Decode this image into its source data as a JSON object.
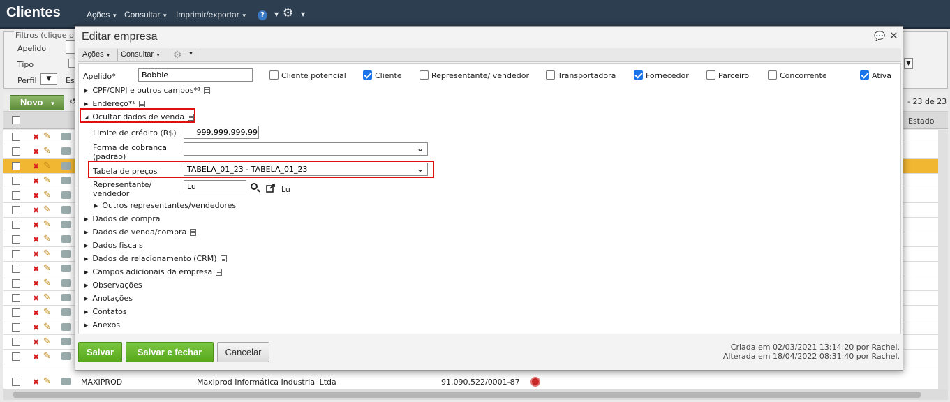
{
  "app": {
    "title": "Clientes",
    "menus": [
      {
        "label": "Ações"
      },
      {
        "label": "Consultar"
      },
      {
        "label": "Imprimir/exportar"
      }
    ],
    "help_label": "?"
  },
  "filters": {
    "legend": "Filtros (clique p",
    "apelido_label": "Apelido",
    "tipo_label": "Tipo",
    "perfil_label": "Perfil",
    "es_label": "Es"
  },
  "grid": {
    "new_label": "Novo",
    "pager": "23 de 23",
    "estado_header": "Estado",
    "last_row": {
      "apelido": "MAXIPROD",
      "nome": "Maxiprod Informática Industrial Ltda",
      "cnpj": "91.090.522/0001-87"
    }
  },
  "dialog": {
    "title": "Editar empresa",
    "toolbar": {
      "acoes": "Ações",
      "consultar": "Consultar"
    },
    "apelido_label": "Apelido*",
    "apelido_value": "Bobbie",
    "checkboxes": [
      {
        "label": "Cliente potencial",
        "checked": false
      },
      {
        "label": "Cliente",
        "checked": true
      },
      {
        "label": "Representante/ vendedor",
        "checked": false
      },
      {
        "label": "Transportadora",
        "checked": false
      },
      {
        "label": "Fornecedor",
        "checked": true
      },
      {
        "label": "Parceiro",
        "checked": false
      },
      {
        "label": "Concorrente",
        "checked": false
      },
      {
        "label": "Ativa",
        "checked": true
      }
    ],
    "sections": {
      "cpf": "CPF/CNPJ e outros campos*¹",
      "endereco": "Endereço*¹",
      "venda": "Ocultar dados de venda"
    },
    "venda": {
      "limite_label": "Limite de crédito (R$)",
      "limite_value": "999.999.999,99",
      "forma_label_1": "Forma de cobrança",
      "forma_label_2": "(padrão)",
      "forma_value": "",
      "tabela_label": "Tabela de preços",
      "tabela_value": "TABELA_01_23 - TABELA_01_23",
      "rep_label_1": "Representante/",
      "rep_label_2": "vendedor",
      "rep_value": "Lu",
      "rep_link": "Lu",
      "outros_rep": "Outros representantes/vendedores"
    },
    "more_sections": [
      "Dados de compra",
      "Dados de venda/compra",
      "Dados fiscais",
      "Dados de relacionamento (CRM)",
      "Campos adicionais da empresa",
      "Observações",
      "Anotações",
      "Contatos",
      "Anexos"
    ],
    "footer": {
      "salvar": "Salvar",
      "salvar_fechar": "Salvar e fechar",
      "cancelar": "Cancelar",
      "criada": "Criada em 02/03/2021 13:14:20 por Rachel.",
      "alterada": "Alterada em 18/04/2022 08:31:40 por Rachel."
    }
  },
  "colors": {
    "topbar": "#2d3e50",
    "selected_row": "#f1b733",
    "accent_green": "#57a91e",
    "highlight": "#e01010"
  }
}
